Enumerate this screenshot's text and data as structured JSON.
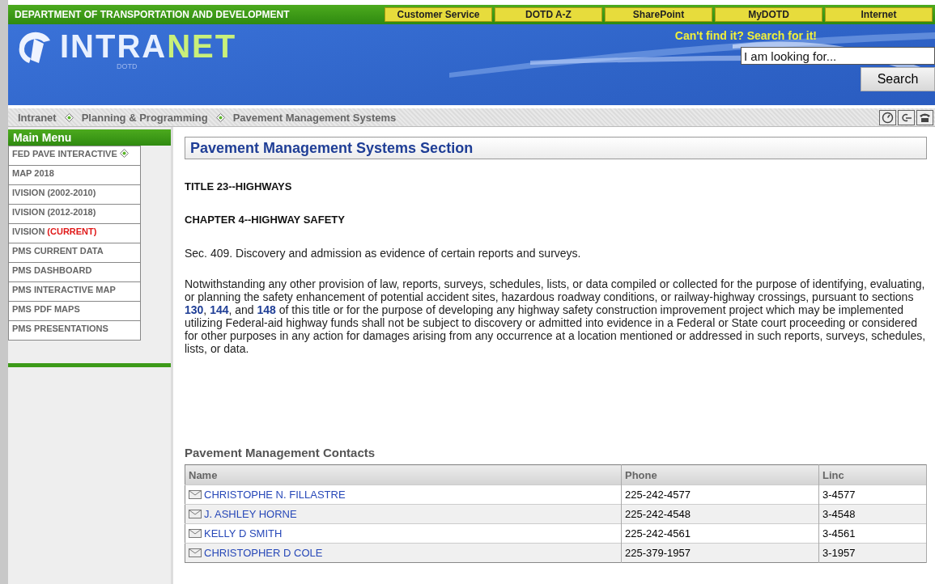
{
  "top_bar": {
    "department": "DEPARTMENT OF TRANSPORTATION AND DEVELOPMENT",
    "links": [
      "Customer Service",
      "DOTD A-Z",
      "SharePoint",
      "MyDOTD",
      "Internet"
    ]
  },
  "header": {
    "logo_main": "INTRA",
    "logo_accent": "NET",
    "logo_sub": "DOTD",
    "search_hint": "Can't find it? Search for it!",
    "search_placeholder": "I am looking for...",
    "search_button": "Search"
  },
  "breadcrumb": [
    "Intranet",
    "Planning & Programming",
    "Pavement Management Systems"
  ],
  "sidebar": {
    "title": "Main Menu",
    "items": [
      {
        "label": "FED PAVE INTERACTIVE",
        "marker": true
      },
      {
        "label": "MAP 2018",
        "marker": false
      },
      {
        "label": "IVISION (2002-2010)",
        "marker": false
      },
      {
        "label": "IVISION (2012-2018)",
        "marker": false
      },
      {
        "label": "IVISION",
        "tag": "(CURRENT)",
        "marker": false
      },
      {
        "label": "PMS CURRENT DATA",
        "marker": false
      },
      {
        "label": "PMS DASHBOARD",
        "marker": false
      },
      {
        "label": "PMS INTERACTIVE MAP",
        "marker": false
      },
      {
        "label": "PMS PDF MAPS",
        "marker": false
      },
      {
        "label": "PMS PRESENTATIONS",
        "marker": false
      }
    ]
  },
  "content": {
    "title": "Pavement Management Systems Section",
    "headings": [
      "TITLE 23--HIGHWAYS",
      "CHAPTER 4--HIGHWAY SAFETY"
    ],
    "section": "Sec. 409. Discovery and admission as evidence of certain reports and surveys.",
    "paragraph": [
      {
        "kind": "text",
        "text": "Notwithstanding any other provision of law, reports, surveys, schedules, lists, or data compiled or collected for the purpose of identifying, evaluating, or planning the safety enhancement of potential accident sites, hazardous roadway conditions, or railway-highway crossings, pursuant to sections "
      },
      {
        "kind": "link",
        "text": "130"
      },
      {
        "kind": "text",
        "text": ", "
      },
      {
        "kind": "link",
        "text": "144"
      },
      {
        "kind": "text",
        "text": ", and "
      },
      {
        "kind": "link",
        "text": "148"
      },
      {
        "kind": "text",
        "text": " of this title or for the purpose of developing any highway safety construction improvement project which may be implemented utilizing Federal-aid highway funds shall not be subject to discovery or admitted into evidence in a Federal or State court proceeding or considered for other purposes in any action for damages arising from any occurrence at a location mentioned or addressed in such reports, surveys, schedules, lists, or data."
      }
    ]
  },
  "contacts": {
    "title": "Pavement Management Contacts",
    "columns": [
      "Name",
      "Phone",
      "Linc"
    ],
    "rows": [
      {
        "name": "CHRISTOPHE N. FILLASTRE",
        "phone": "225-242-4577",
        "linc": "3-4577"
      },
      {
        "name": "J. ASHLEY HORNE",
        "phone": "225-242-4548",
        "linc": "3-4548"
      },
      {
        "name": "KELLY D SMITH",
        "phone": "225-242-4561",
        "linc": "3-4561"
      },
      {
        "name": "CHRISTOPHER D COLE",
        "phone": "225-379-1957",
        "linc": "3-1957"
      }
    ]
  }
}
